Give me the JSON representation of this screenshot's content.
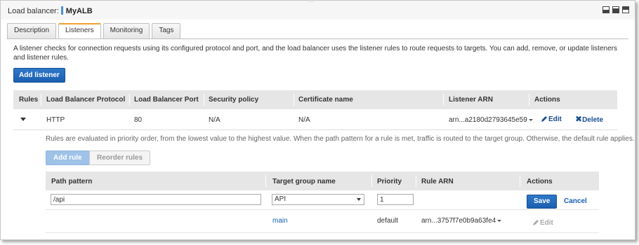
{
  "header": {
    "label": "Load balancer:",
    "name": "MyALB"
  },
  "tabs": [
    {
      "label": "Description"
    },
    {
      "label": "Listeners"
    },
    {
      "label": "Monitoring"
    },
    {
      "label": "Tags"
    }
  ],
  "active_tab": "Listeners",
  "description": "A listener checks for connection requests using its configured protocol and port, and the load balancer uses the listener rules to route requests to targets. You can add, remove, or update listeners and listener rules.",
  "add_listener_label": "Add listener",
  "listener_table": {
    "columns": [
      "Rules",
      "Load Balancer Protocol",
      "Load Balancer Port",
      "Security policy",
      "Certificate name",
      "Listener ARN",
      "Actions"
    ],
    "row": {
      "protocol": "HTTP",
      "port": "80",
      "security_policy": "N/A",
      "certificate": "N/A",
      "arn": "arn...a2180d2793645e59",
      "edit_label": "Edit",
      "delete_label": "Delete"
    }
  },
  "rules": {
    "note": "Rules are evaluated in priority order, from the lowest value to the highest value. When the path pattern for a rule is met, traffic is routed to the target group. Otherwise, the default rule applies.",
    "add_rule_label": "Add rule",
    "reorder_label": "Reorder rules",
    "columns": [
      "Path pattern",
      "Target group name",
      "Priority",
      "Rule ARN",
      "Actions"
    ],
    "edit_row": {
      "path_value": "/api",
      "target_group": "API",
      "priority": "1",
      "save_label": "Save",
      "cancel_label": "Cancel"
    },
    "default_row": {
      "target_group": "main",
      "priority": "default",
      "arn": "arn...3757f7e0b9a63fe4",
      "edit_label": "Edit"
    }
  },
  "colors": {
    "primary_button": "#1b5fb0",
    "active_tab_accent": "#f0a033",
    "link": "#1a5fb4"
  }
}
